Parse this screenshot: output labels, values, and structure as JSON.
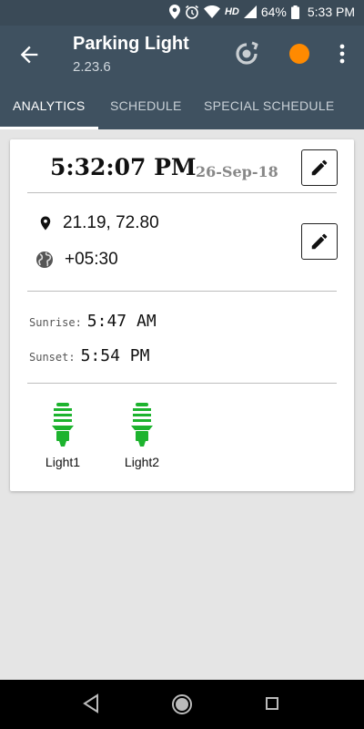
{
  "status_bar": {
    "network": "HD",
    "battery": "64%",
    "clock": "5:33 PM",
    "icons": [
      "location-icon",
      "alarm-icon",
      "wifi-icon",
      "signal-icon",
      "battery-icon"
    ]
  },
  "app_bar": {
    "title": "Parking Light",
    "version": "2.23.6",
    "status_dot_color": "#ff8a00"
  },
  "tabs": [
    {
      "label": "ANALYTICS",
      "active": true
    },
    {
      "label": "SCHEDULE",
      "active": false
    },
    {
      "label": "SPECIAL SCHEDULE",
      "active": false
    }
  ],
  "card": {
    "time": "5:32:07 PM",
    "date": "26-Sep-18",
    "coordinates": "21.19, 72.80",
    "timezone": "+05:30",
    "sunrise_label": "Sunrise:",
    "sunrise_value": "5:47 AM",
    "sunset_label": "Sunset:",
    "sunset_value": "5:54 PM",
    "lights": [
      {
        "label": "Light1",
        "color": "#1db32e"
      },
      {
        "label": "Light2",
        "color": "#1db32e"
      }
    ]
  }
}
